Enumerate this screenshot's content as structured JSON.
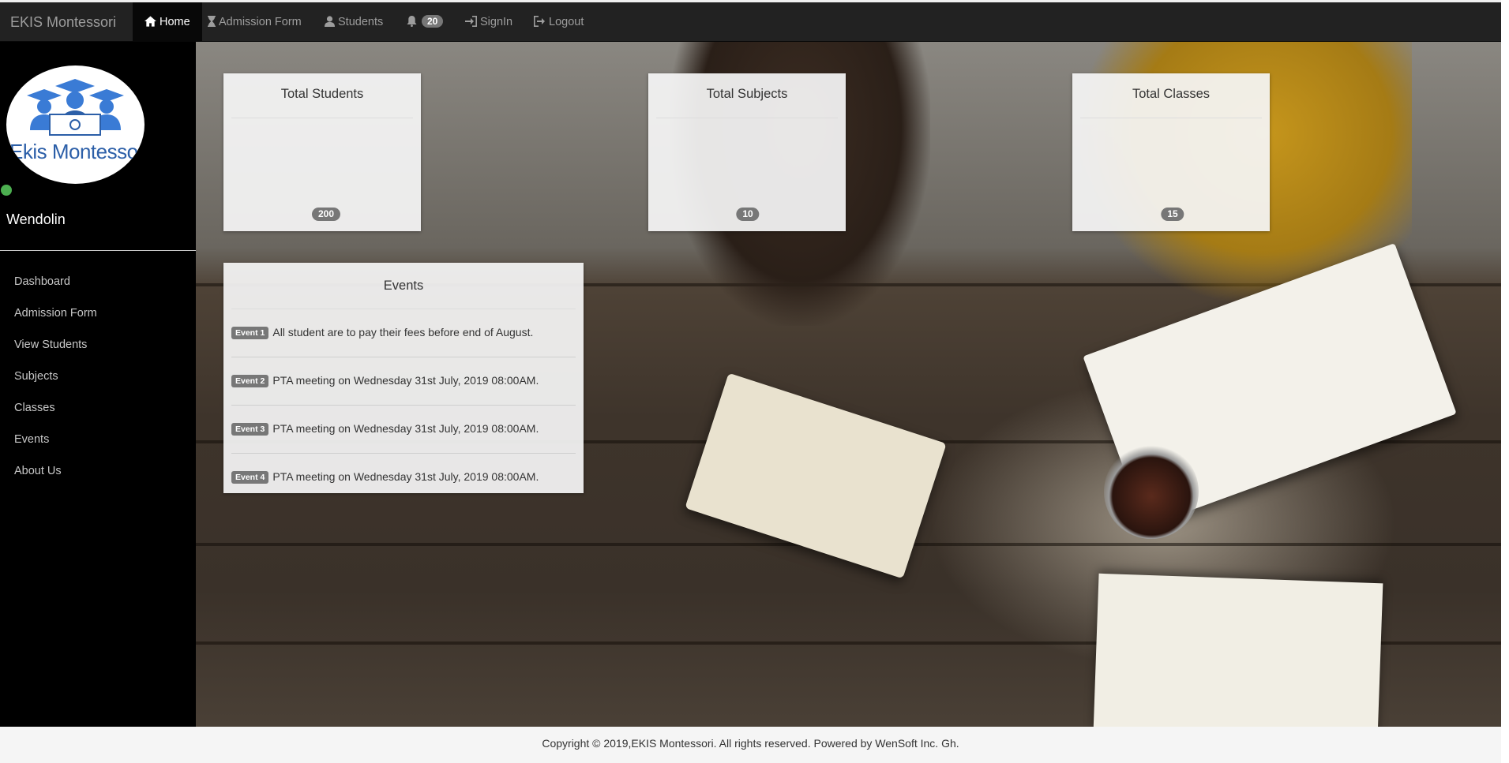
{
  "navbar": {
    "brand": "EKIS Montessori",
    "items": [
      {
        "label": "Home",
        "icon": "home-icon",
        "active": true
      },
      {
        "label": "Admission Form",
        "icon": "hourglass-icon"
      },
      {
        "label": "Students",
        "icon": "user-icon"
      },
      {
        "label": "",
        "icon": "bell-icon",
        "badge": "20"
      },
      {
        "label": "SignIn",
        "icon": "sign-in-icon"
      },
      {
        "label": "Logout",
        "icon": "logout-icon"
      }
    ]
  },
  "sidebar": {
    "logo_text": "Ekis Montessori",
    "username": "Wendolin",
    "status_color": "#4caf50",
    "items": [
      {
        "label": "Dashboard"
      },
      {
        "label": "Admission Form"
      },
      {
        "label": "View Students"
      },
      {
        "label": "Subjects"
      },
      {
        "label": "Classes"
      },
      {
        "label": "Events"
      },
      {
        "label": "About Us"
      }
    ]
  },
  "stats": [
    {
      "title": "Total Students",
      "value": "200"
    },
    {
      "title": "Total Subjects",
      "value": "10"
    },
    {
      "title": "Total Classes",
      "value": "15"
    }
  ],
  "events": {
    "title": "Events",
    "items": [
      {
        "label": "Event 1",
        "text": "All student are to pay their fees before end of August."
      },
      {
        "label": "Event 2",
        "text": "PTA meeting on Wednesday 31st July, 2019 08:00AM."
      },
      {
        "label": "Event 3",
        "text": "PTA meeting on Wednesday 31st July, 2019 08:00AM."
      },
      {
        "label": "Event 4",
        "text": "PTA meeting on Wednesday 31st July, 2019 08:00AM."
      }
    ]
  },
  "footer": {
    "text": "Copyright © 2019,EKIS Montessori. All rights reserved. Powered by WenSoft Inc. Gh."
  },
  "colors": {
    "navbar_bg": "#222222",
    "sidebar_bg": "#000000",
    "badge_bg": "#777777",
    "logo_blue": "#2c5fa8"
  }
}
